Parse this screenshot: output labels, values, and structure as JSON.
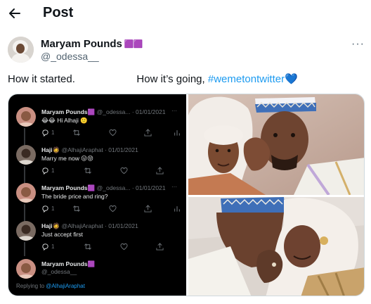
{
  "header": {
    "title": "Post"
  },
  "author": {
    "name": "Maryam Pounds",
    "name_emoji": "🟪🟪",
    "handle": "@_odessa__"
  },
  "tweet": {
    "part1": "How it started.",
    "gap": "                     ",
    "part2": "How it’s going, ",
    "hashtag": "#wemetontwitter",
    "emoji": "💙"
  },
  "thread": {
    "entries": [
      {
        "name": "Maryam Pounds",
        "badge": "🟪",
        "meta": "@_odessa... · 01/01/2021",
        "text": "😂😂 Hi Alhaji 🙂",
        "reply_count": "1",
        "has_stats": true
      },
      {
        "name": "Haji",
        "badge": "🧔",
        "meta": "@AlhajiAraphat · 01/01/2021",
        "text": "Marry me now 😛😝",
        "reply_count": "1",
        "has_stats": false
      },
      {
        "name": "Maryam Pounds",
        "badge": "🟪",
        "meta": "@_odessa... · 01/01/2021",
        "text": "The bride price and ring?",
        "reply_count": "1",
        "has_stats": true
      },
      {
        "name": "Haji",
        "badge": "🧔",
        "meta": "@AlhajiAraphat · 01/01/2021",
        "text": "Just accept first",
        "reply_count": "1",
        "has_stats": false
      }
    ],
    "final": {
      "name": "Maryam Pounds",
      "badge": "🟪",
      "handle": "@_odessa__"
    },
    "replying_prefix": "Replying to ",
    "replying_handle": "@AlhajiAraphat",
    "dots": "···"
  },
  "colors": {
    "accent": "#1d9bf0",
    "dark_bg": "#000000",
    "muted": "#536471"
  },
  "icons": [
    "back-arrow-icon",
    "more-icon",
    "reply-icon",
    "retweet-icon",
    "like-icon",
    "share-icon",
    "stats-icon"
  ]
}
